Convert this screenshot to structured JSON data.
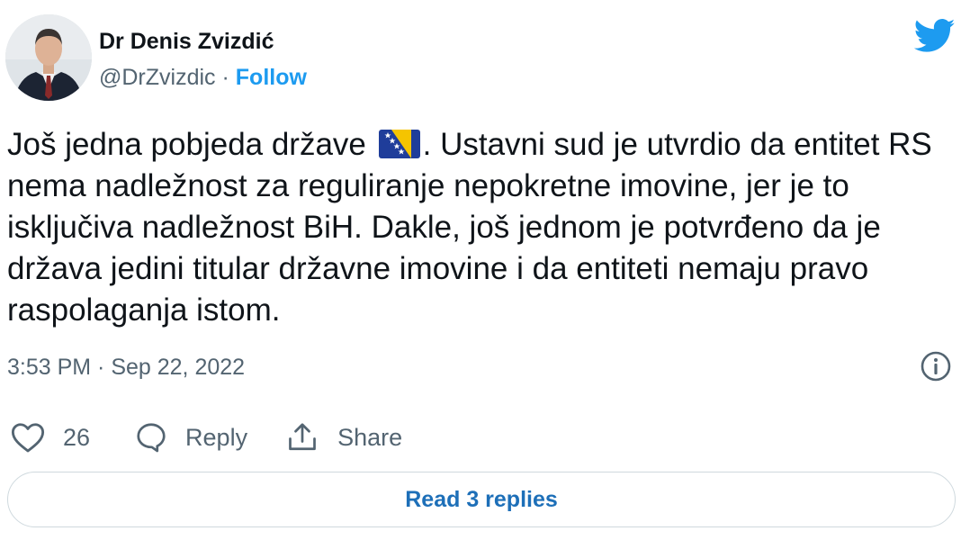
{
  "author": {
    "display_name": "Dr Denis Zvizdić",
    "handle": "@DrZvizdic",
    "separator": "·",
    "follow_label": "Follow"
  },
  "tweet": {
    "text_before_flag": "Još jedna pobjeda države",
    "flag_icon": "bosnia-herzegovina-flag-icon",
    "text_after_flag": ". Ustavni sud je utvrdio da entitet RS nema nadležnost za reguliranje nepokretne imovine, jer je to isključiva nadležnost BiH. Dakle, još jednom je potvrđeno da je država jedini titular državne imovine i da entiteti nemaju pravo raspolaganja istom."
  },
  "meta": {
    "timestamp": "3:53 PM · Sep 22, 2022"
  },
  "actions": {
    "like_count": "26",
    "reply_label": "Reply",
    "share_label": "Share"
  },
  "footer": {
    "read_replies_label": "Read 3 replies"
  },
  "colors": {
    "twitter_blue": "#1d9bf0",
    "text_primary": "#0f1419",
    "text_secondary": "#536471",
    "border": "#cfd9de"
  }
}
